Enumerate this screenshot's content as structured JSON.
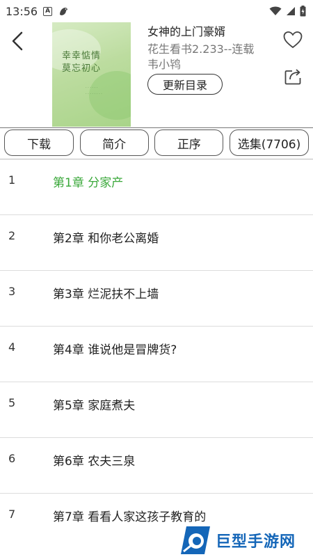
{
  "status_bar": {
    "time": "13:56",
    "icons": [
      "a-box-icon",
      "bird-icon",
      "wifi-icon",
      "signal-icon",
      "battery-icon"
    ]
  },
  "book": {
    "title": "女神的上门豪婿",
    "source": "花生看书2.233--连载",
    "author": "韦小鸨",
    "update_button": "更新目录",
    "cover_text_line1": "幸幸惦情",
    "cover_text_line2": "莫忘初心"
  },
  "tabs": [
    {
      "label": "下载"
    },
    {
      "label": "简介"
    },
    {
      "label": "正序"
    },
    {
      "label": "选集(7706)"
    }
  ],
  "chapters": [
    {
      "num": "1",
      "title": "第1章 分家产",
      "active": true
    },
    {
      "num": "2",
      "title": "第2章 和你老公离婚",
      "active": false
    },
    {
      "num": "3",
      "title": "第3章 烂泥扶不上墙",
      "active": false
    },
    {
      "num": "4",
      "title": "第4章 谁说他是冒牌货?",
      "active": false
    },
    {
      "num": "5",
      "title": "第5章 家庭煮夫",
      "active": false
    },
    {
      "num": "6",
      "title": "第6章 农夫三泉",
      "active": false
    },
    {
      "num": "7",
      "title": "第7章 看看人家这孩子教育的",
      "active": false
    }
  ],
  "watermark": {
    "text": "巨型手游网"
  },
  "colors": {
    "active_chapter": "#3aa83a",
    "watermark_blue": "#1466b8"
  }
}
